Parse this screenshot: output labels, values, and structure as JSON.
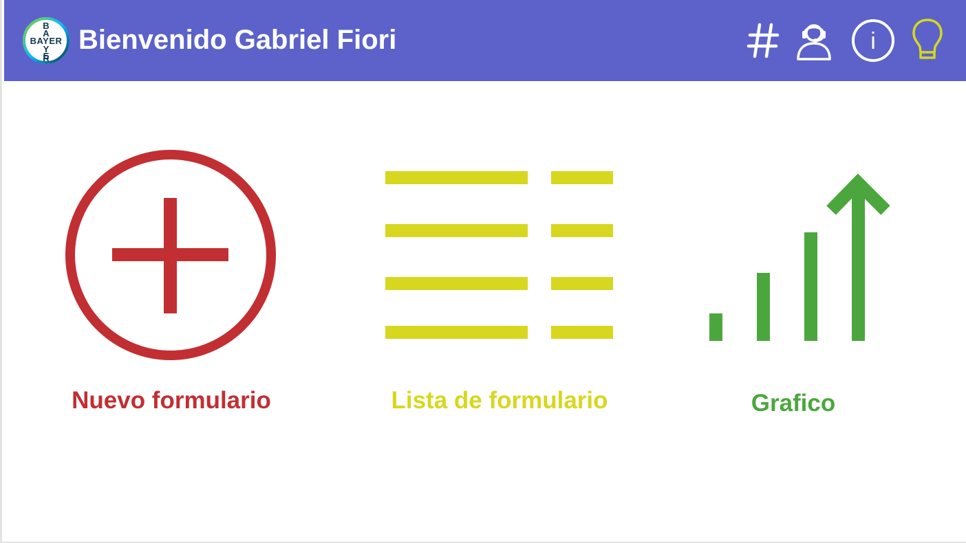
{
  "header": {
    "logo": {
      "icon": "bayer-cross-logo",
      "text": "BAYER"
    },
    "title": "Bienvenido Gabriel Fiori",
    "background_color": "#5c62c9",
    "actions": [
      {
        "name": "hash",
        "icon": "hash-icon",
        "label": "#",
        "color": "#ffffff"
      },
      {
        "name": "support",
        "icon": "headset-user-icon",
        "color": "#ffffff"
      },
      {
        "name": "info",
        "icon": "info-circle-icon",
        "label": "i",
        "color": "#ffffff"
      },
      {
        "name": "tips",
        "icon": "lightbulb-icon",
        "color": "#d6d720"
      }
    ]
  },
  "tiles": [
    {
      "label": "Nuevo formulario",
      "icon": "plus-circle-icon",
      "color": "#c12f33"
    },
    {
      "label": "Lista de formulario",
      "icon": "list-icon",
      "color": "#d7d720"
    },
    {
      "label": "Grafico",
      "icon": "growth-chart-icon",
      "color": "#4ba73d"
    }
  ]
}
